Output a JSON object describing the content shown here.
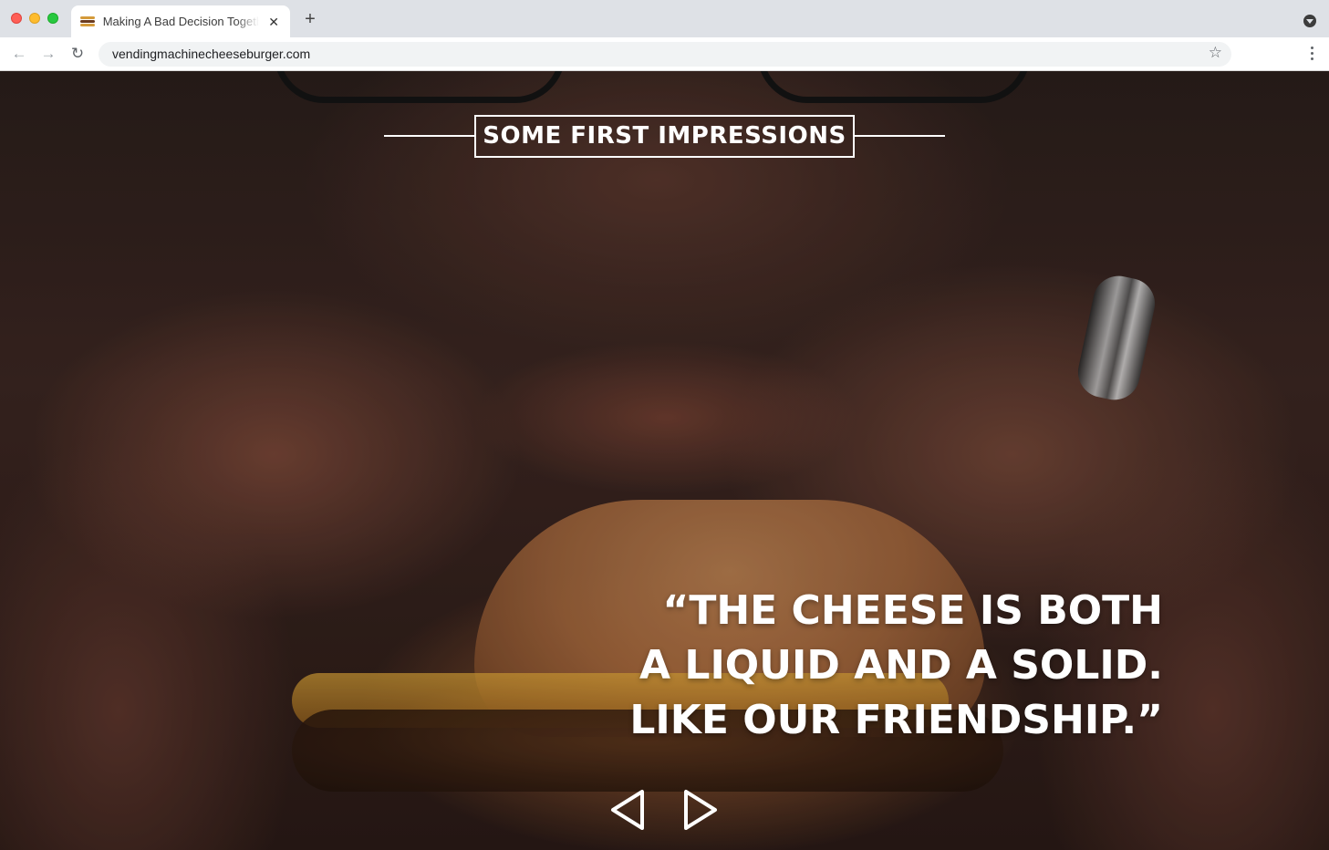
{
  "browser": {
    "tab": {
      "title": "Making A Bad Decision Together",
      "close_glyph": "✕",
      "favicon": "burger-icon"
    },
    "new_tab_glyph": "+",
    "nav": {
      "back_glyph": "←",
      "forward_glyph": "→",
      "reload_glyph": "↻"
    },
    "url": "vendingmachinecheeseburger.com",
    "bookmark_glyph": "☆"
  },
  "page": {
    "heading": "SOME FIRST IMPRESSIONS",
    "quote_lines": [
      "“THE CHEESE IS BOTH",
      "A LIQUID AND A SOLID.",
      "LIKE OUR FRIENDSHIP.”"
    ],
    "carousel": {
      "prev_icon": "triangle-left-icon",
      "next_icon": "triangle-right-icon"
    },
    "colors": {
      "text": "#ffffff",
      "tab_bar": "#dee1e6"
    }
  }
}
